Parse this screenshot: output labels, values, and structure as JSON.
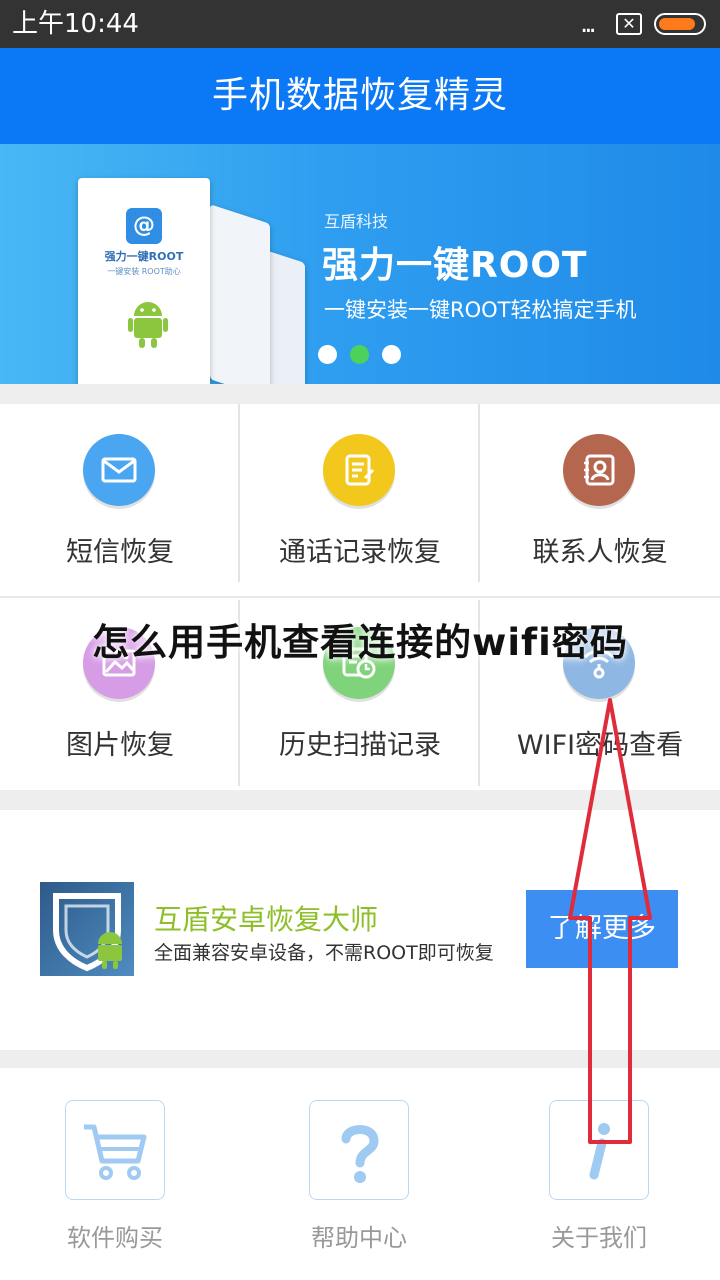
{
  "status_bar": {
    "time": "上午10:44",
    "dots": "...",
    "sim": "✕",
    "battery_color": "#ff7a1a"
  },
  "header": {
    "title": "手机数据恢复精灵",
    "color": "#0b78f5"
  },
  "banner": {
    "brand": "互盾科技",
    "headline": "强力一键ROOT",
    "subline": "一键安装一键ROOT轻松搞定手机",
    "phone_caption": "强力一键ROOT",
    "phone_sub": "一键安装 ROOT助心",
    "pager": {
      "count": 3,
      "active_index": 1
    }
  },
  "grid": {
    "items": [
      {
        "label": "短信恢复",
        "icon": "mail-icon",
        "color": "#4aa6f0"
      },
      {
        "label": "通话记录恢复",
        "icon": "call-log-icon",
        "color": "#f2c81d"
      },
      {
        "label": "联系人恢复",
        "icon": "contacts-icon",
        "color": "#b5664f"
      },
      {
        "label": "图片恢复",
        "icon": "image-icon",
        "color": "#d69ce6"
      },
      {
        "label": "历史扫描记录",
        "icon": "history-icon",
        "color": "#7fd37a"
      },
      {
        "label": "WIFI密码查看",
        "icon": "wifi-key-icon",
        "color": "#8fb7e3"
      }
    ]
  },
  "promo": {
    "title": "互盾安卓恢复大师",
    "subtitle": "全面兼容安卓设备，不需ROOT即可恢复",
    "button": "了解更多",
    "title_color": "#8cbf28",
    "button_color": "#3d8ef2"
  },
  "bottom_nav": {
    "items": [
      {
        "label": "软件购买",
        "icon": "cart-icon"
      },
      {
        "label": "帮助中心",
        "icon": "help-icon"
      },
      {
        "label": "关于我们",
        "icon": "info-icon"
      }
    ]
  },
  "overlay": {
    "caption": "怎么用手机查看连接的wifi密码",
    "arrow_color": "#e02b3a"
  }
}
